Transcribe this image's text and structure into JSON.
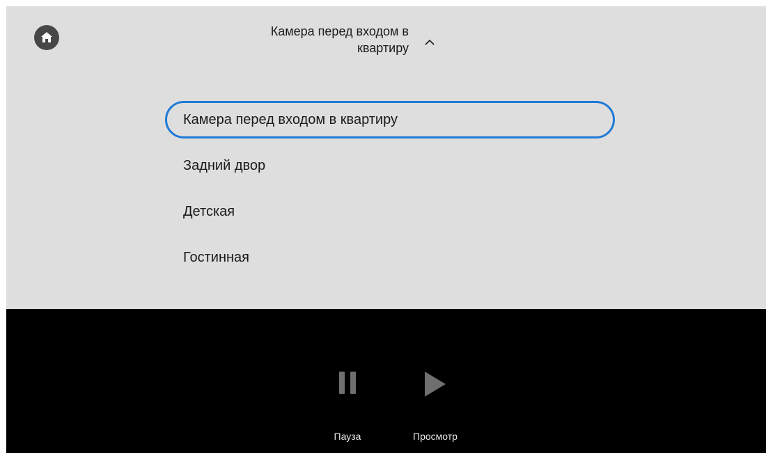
{
  "header": {
    "home_icon": "home-icon",
    "camera_selector_title": "Камера перед входом в квартиру",
    "chevron_icon": "chevron-up-icon"
  },
  "camera_list": {
    "selected_index": 0,
    "items": [
      {
        "label": "Камера перед входом в квартиру"
      },
      {
        "label": "Задний двор"
      },
      {
        "label": "Детская"
      },
      {
        "label": "Гостинная"
      }
    ]
  },
  "controls": {
    "pause": {
      "label": "Пауза",
      "icon": "pause-icon"
    },
    "play": {
      "label": "Просмотр",
      "icon": "play-icon"
    }
  },
  "colors": {
    "panel_bg": "#dedede",
    "selection_accent": "#1f7ad6",
    "video_bg": "#000000",
    "control_icon": "#6f6f6f"
  }
}
